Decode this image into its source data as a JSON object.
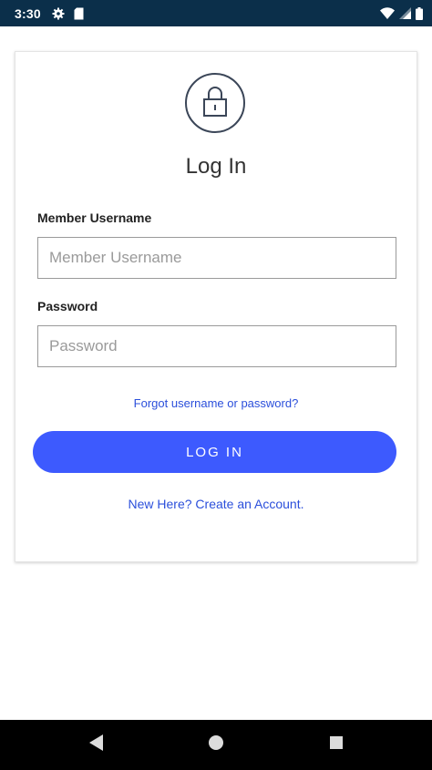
{
  "status_bar": {
    "time": "3:30",
    "icons": [
      "settings-icon",
      "sim-card-icon",
      "wifi-icon",
      "signal-icon",
      "battery-icon"
    ]
  },
  "login_card": {
    "header_icon": "lock-icon",
    "title": "Log In",
    "username": {
      "label": "Member Username",
      "placeholder": "Member Username",
      "value": ""
    },
    "password": {
      "label": "Password",
      "placeholder": "Password",
      "value": ""
    },
    "forgot_link": "Forgot username or password?",
    "login_button": "LOG IN",
    "create_account_link": "New Here? Create an Account."
  },
  "nav_bar": {
    "buttons": [
      "back-icon",
      "home-icon",
      "recents-icon"
    ]
  },
  "colors": {
    "status_bar_bg": "#0b2f4a",
    "accent": "#3d5afe",
    "link": "#2b4fdb",
    "nav_bar_bg": "#000000"
  }
}
